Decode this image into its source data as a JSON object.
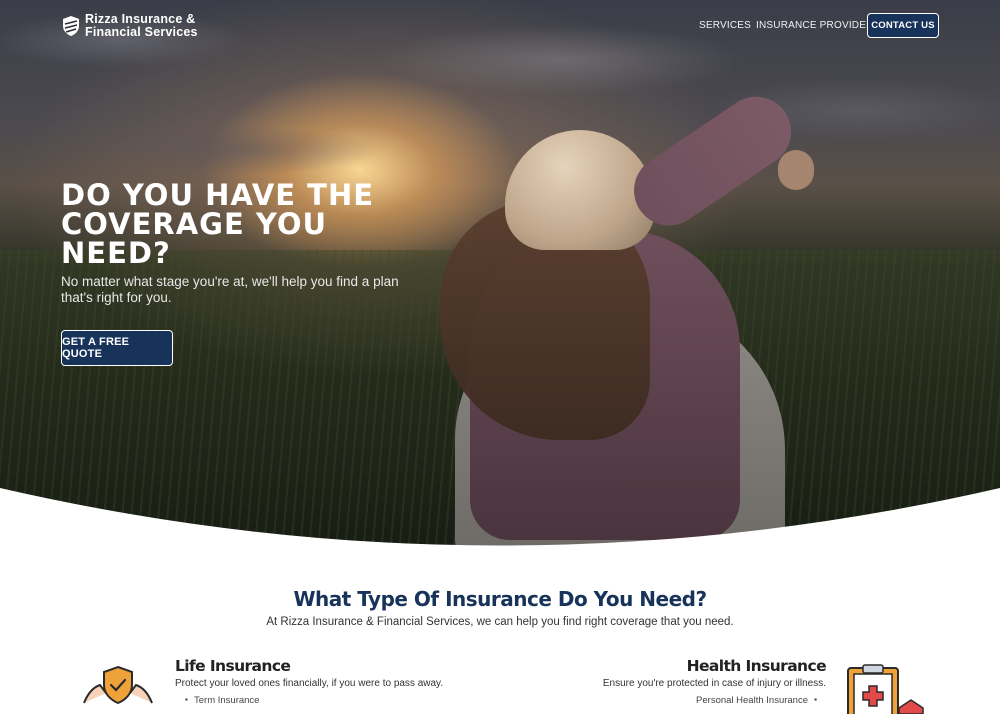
{
  "header": {
    "logo_line1": "Rizza Insurance &",
    "logo_line2": "Financial Services",
    "logo_icon": "shield-logo-icon",
    "nav": [
      {
        "label": "SERVICES"
      },
      {
        "label": "INSURANCE PROVIDERS"
      }
    ],
    "contact_label": "CONTACT US"
  },
  "hero": {
    "title": "DO YOU HAVE THE COVERAGE YOU NEED?",
    "subtitle": "No matter what stage you're at, we'll help you find a plan that's right for you.",
    "cta_label": "GET A FREE QUOTE"
  },
  "insurance": {
    "heading": "What Type Of Insurance Do You Need?",
    "subheading": "At Rizza Insurance & Financial Services, we can help you find right coverage that you need.",
    "cards": [
      {
        "title": "Life Insurance",
        "description": "Protect your loved ones financially, if you were to pass away.",
        "items": [
          "Term Insurance"
        ],
        "icon": "hands-shield-icon"
      },
      {
        "title": "Health Insurance",
        "description": "Ensure you're protected in case of injury or illness.",
        "items": [
          "Personal Health Insurance"
        ],
        "icon": "medical-clipboard-icon"
      }
    ]
  },
  "colors": {
    "brand_navy": "#173359",
    "text_dark": "#222222",
    "icon_orange": "#f0a23a",
    "icon_red": "#e24a4a"
  }
}
